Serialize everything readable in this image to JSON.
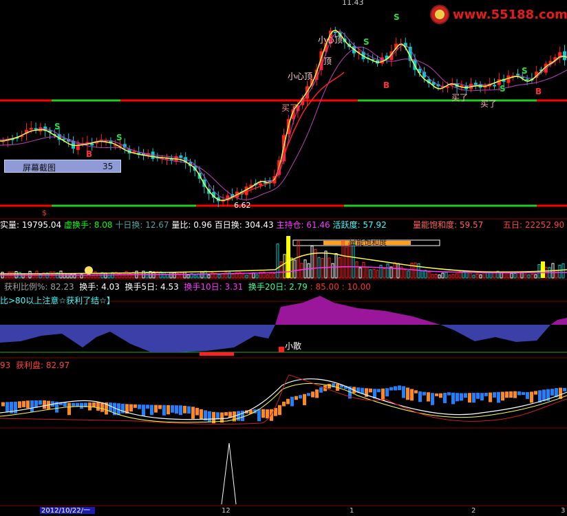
{
  "logo": {
    "text": "www.55188.com"
  },
  "screenshot_box": {
    "label": "屏幕截图",
    "value": "35"
  },
  "main_chart": {
    "price_high": "11.43",
    "price_low": "6.62",
    "annotations": {
      "s1": "S",
      "s2": "S",
      "s3": "S",
      "s4": "S",
      "s5": "S",
      "s6": "S",
      "b1": "B",
      "b2": "B",
      "b3": "B",
      "buy1": "买了",
      "buy2": "买了",
      "buy3": "买了",
      "top1": "小心顶",
      "top2": "小心顶",
      "top3": "顶",
      "dollar": "$"
    }
  },
  "vol_header": {
    "items": [
      {
        "label": "实量",
        "value": "19795.04",
        "color": "#ffffff",
        "lcolor": "#ffffff"
      },
      {
        "label": "虚换手",
        "value": "8.08",
        "color": "#00ff00",
        "lcolor": "#00ff00"
      },
      {
        "label": "十日换",
        "value": "12.67",
        "color": "#5aa0a0",
        "lcolor": "#5aa0a0"
      },
      {
        "label": "量比",
        "value": "0.96",
        "color": "#ffffff",
        "lcolor": "#ffffff"
      },
      {
        "label": "百日换",
        "value": "304.43",
        "color": "#ffffff",
        "lcolor": "#ffffff"
      },
      {
        "label": "主持仓",
        "value": "61.46",
        "color": "#ff33ff",
        "lcolor": "#ff33ff"
      },
      {
        "label": "活跃度",
        "value": "57.92",
        "color": "#33ffff",
        "lcolor": "#33ffff"
      }
    ],
    "saturation": {
      "label": "量能饱和度",
      "value": "59.57"
    },
    "five_day": {
      "label": "五日",
      "value": "22252.90"
    },
    "bar_label": "量能饱和度"
  },
  "profit_header": {
    "ratio_label": "获利比例%",
    "ratio_value": "82.23",
    "h1_label": "换手",
    "h1_value": "4.03",
    "h5_label": "换手5日",
    "h5_value": "4.53",
    "h10_label": "换手10日",
    "h10_value": "3.31",
    "h20_label": "换手20日",
    "h20_value": "2.79",
    "lvl1": "85.00",
    "lvl2": "10.00",
    "hint": "比>80以上注意☆获利了结☆】",
    "small_scatter": "小散"
  },
  "profit_panel2": {
    "left_num": "93",
    "label": "获利盘",
    "value": "82.97"
  },
  "axis": {
    "date": "2012/10/22/一",
    "ticks": [
      "12",
      "1",
      "2",
      "3"
    ]
  },
  "colors": {
    "up": "#ff2020",
    "down": "#00d0d0",
    "ma_yellow": "#ffff40",
    "ma_magenta": "#c040c0",
    "green": "#22cc22",
    "red_line": "#ff0000",
    "purple_fill": "#9a169a",
    "blue_fill": "#3a40a8"
  }
}
